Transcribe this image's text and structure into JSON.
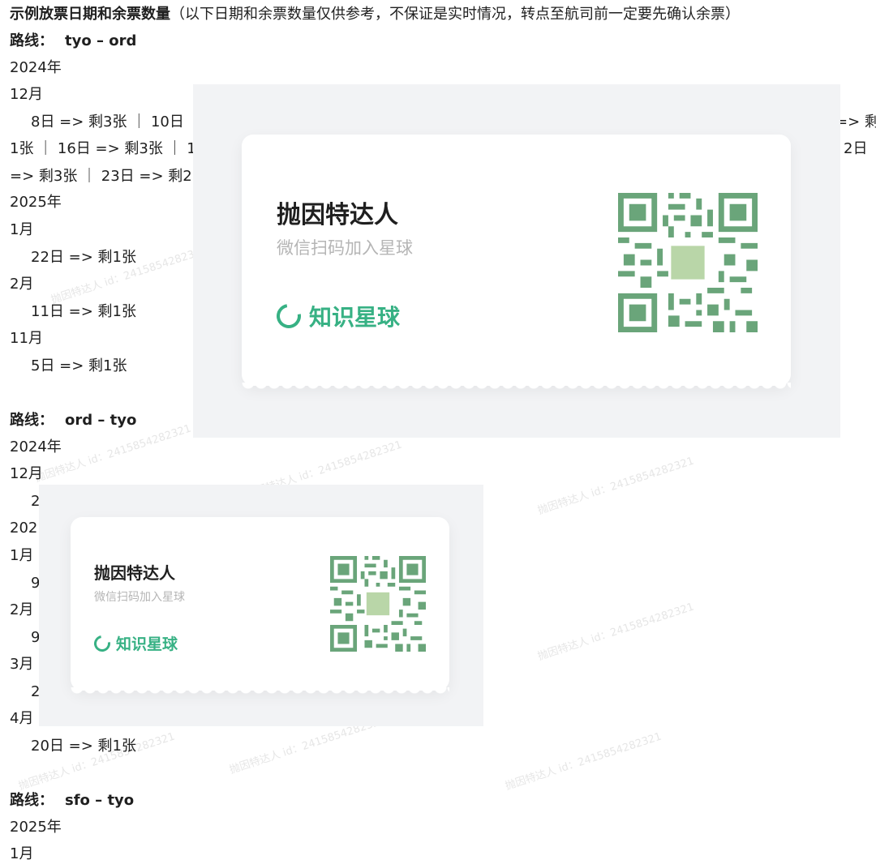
{
  "heading": {
    "title": "示例放票日期和余票数量",
    "note": "（以下日期和余票数量仅供参考，不保证是实时情况，转点至航司前一定要先确认余票）"
  },
  "routes": [
    {
      "label": "路线：",
      "value": "tyo – ord",
      "lines": [
        "2024年",
        "12月",
        "8日 => 剩3张 ｜ 10日",
        "=> 剩",
        "1张 ｜ 16日 => 剩3张 ｜ 1",
        "2日",
        "=> 剩3张 ｜ 23日 => 剩2",
        "2025年",
        "1月",
        "22日 => 剩1张",
        "2月",
        "11日 => 剩1张",
        "11月",
        "5日 => 剩1张"
      ]
    },
    {
      "label": "路线：",
      "value": "ord – tyo",
      "lines": [
        "2024年",
        "12月",
        "2",
        "202",
        "1月",
        "9",
        "2月",
        "9",
        "3月",
        "2",
        "4月",
        "20日 => 剩1张"
      ]
    },
    {
      "label": "路线：",
      "value": "sfo – tyo",
      "lines": [
        "2025年",
        "1月"
      ]
    }
  ],
  "promo": {
    "title": "抛因特达人",
    "subtitle": "微信扫码加入星球",
    "brand": "知识星球"
  },
  "watermark": "抛因特达人 id：2415854282321",
  "colors": {
    "brand_green": "#37b184",
    "qr_green": "#6aa57a",
    "overlay_bg": "#f2f3f5"
  }
}
